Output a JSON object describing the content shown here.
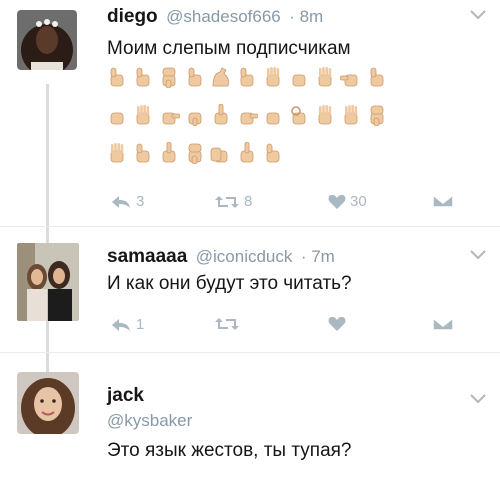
{
  "tweets": [
    {
      "name": "diego",
      "handle": "@shadesof666",
      "time": "· 8m",
      "text": "Моим слепым подписчикам",
      "emoji_rows": [
        [
          "thumbs-up",
          "thumbs-up",
          "thumbs-down",
          "thumbs-up",
          "flexed-biceps",
          "thumbs-up",
          "vulcan-salute",
          "fist",
          "raised-hand",
          "point-left",
          "thumbs-up"
        ],
        [
          "fist",
          "raised-hand",
          "point-right",
          "point-down",
          "point-up",
          "point-right",
          "fist",
          "ok-hand",
          "vulcan-salute",
          "raised-hand",
          "thumbs-down"
        ],
        [
          "raised-hand",
          "thumbs-up",
          "point-up",
          "thumbs-down",
          "clapping",
          "point-up",
          "thumbs-up"
        ]
      ],
      "actions": {
        "reply": "3",
        "retweet": "8",
        "like": "30"
      }
    },
    {
      "name": "samaaaa",
      "handle": "@iconicduck",
      "time": "· 7m",
      "text": "И как они будут это читать?",
      "actions": {
        "reply": "1",
        "retweet": "",
        "like": ""
      }
    },
    {
      "name": "jack",
      "handle": "@kysbaker",
      "text": "Это язык жестов, ты тупая?"
    }
  ],
  "colors": {
    "text": "#14171a",
    "muted": "#8899a6",
    "icon": "#aab8c2",
    "thread": "#d7dce0",
    "skin": "#efc9a0",
    "skin_dark": "#c99a6b"
  }
}
